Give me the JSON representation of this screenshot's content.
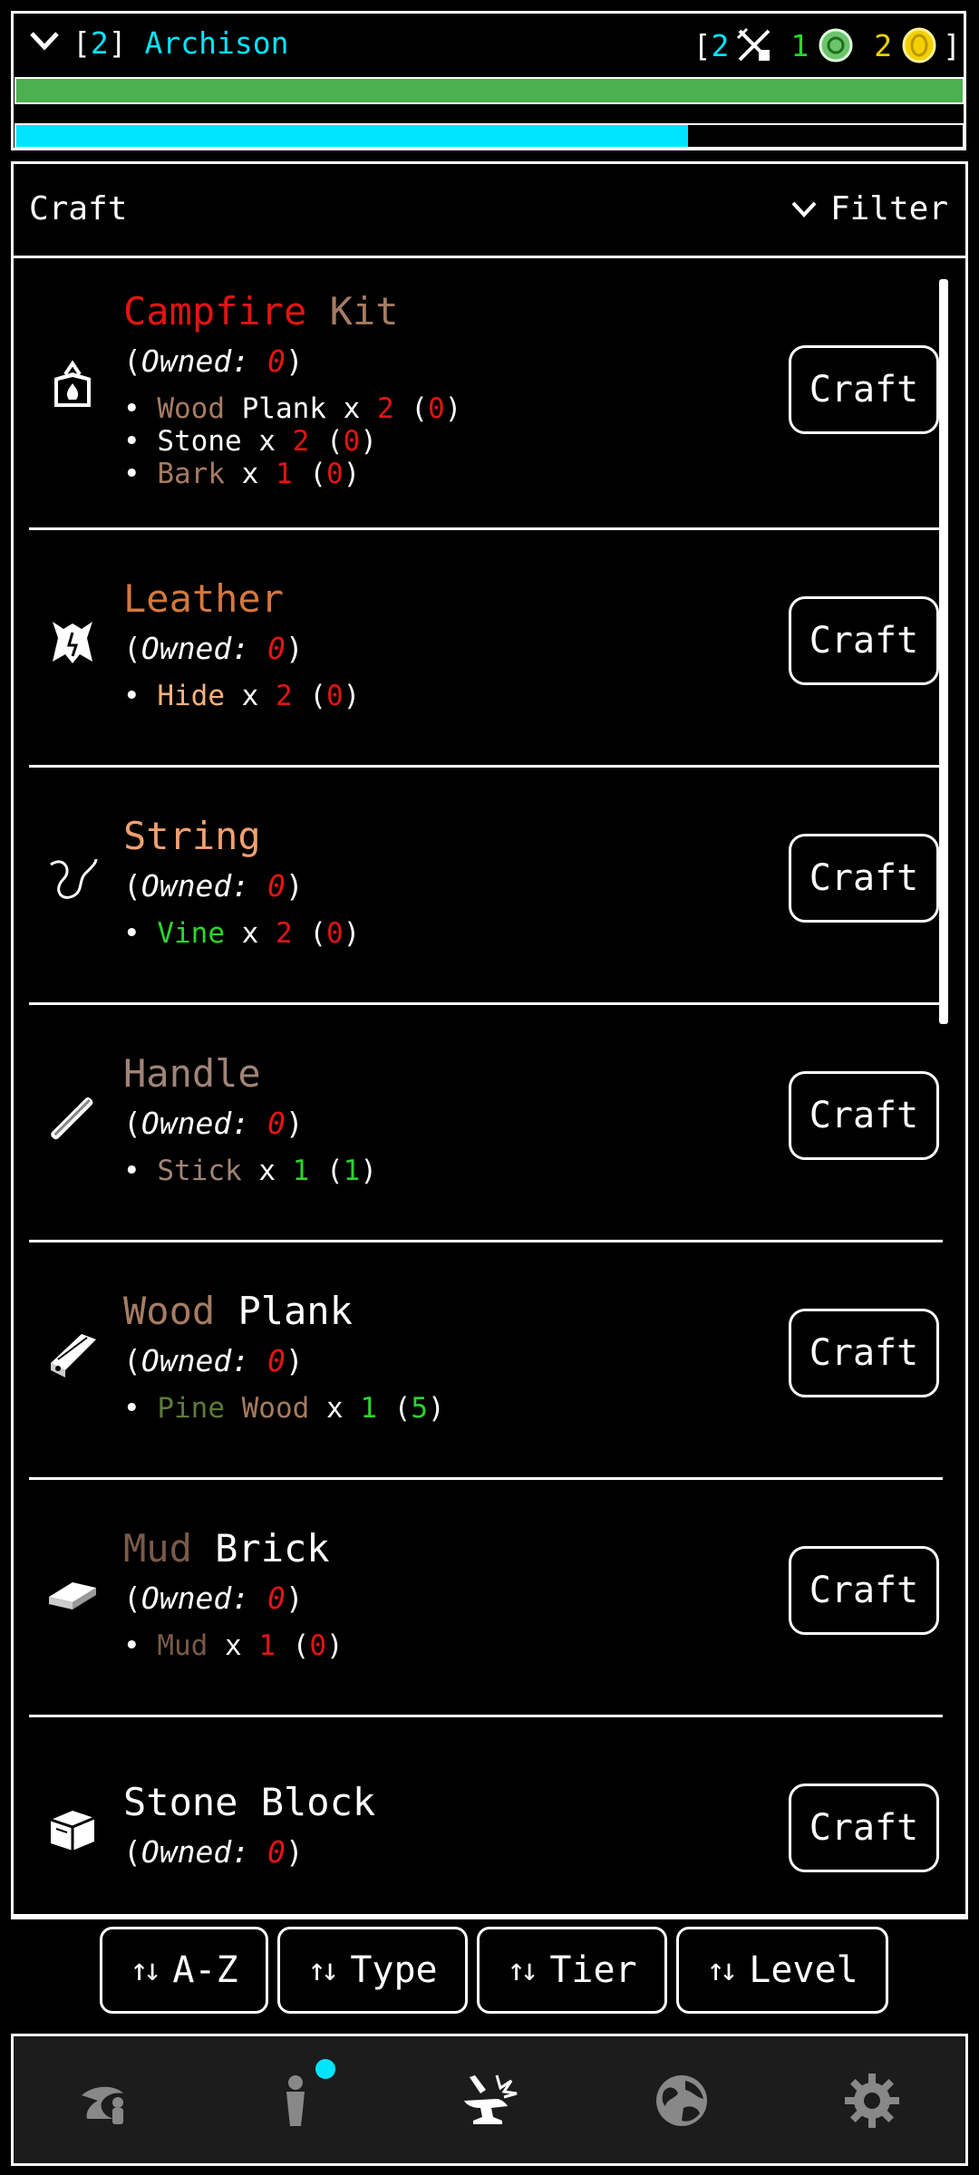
{
  "header": {
    "level_open": "[",
    "level": "2",
    "level_close": "]",
    "name": "Archison",
    "currency": {
      "open": "[",
      "a_value": "2",
      "b_value": "1",
      "c_value": "2",
      "close": "]",
      "a_icon": "sword-shovel-icon",
      "b_icon": "green-token-icon",
      "c_icon": "gold-coin-icon"
    },
    "hp_fill": 1.0,
    "xp_fill": 0.71,
    "colors": {
      "cyan": "#00e5ff",
      "green": "#4caf50",
      "gold": "#f5d000"
    }
  },
  "panel": {
    "title": "Craft",
    "filter_label": "Filter"
  },
  "craft_button_label": "Craft",
  "owned_label": "Owned:",
  "items": [
    {
      "title1": "Campfire",
      "title2": "Kit",
      "c1": "#e31414",
      "c2": "#a67c62",
      "owned": "0",
      "icon": "campfire-kit-icon",
      "reqs": [
        {
          "n1": "Wood",
          "n2": " Plank",
          "c1": "#a67c62",
          "c2": "#ffffff",
          "qty": "2",
          "have": "0",
          "ok": false
        },
        {
          "n1": "Stone",
          "n2": "",
          "c1": "#ffffff",
          "c2": "#ffffff",
          "qty": "2",
          "have": "0",
          "ok": false
        },
        {
          "n1": "Bark",
          "n2": "",
          "c1": "#a67c62",
          "c2": "#ffffff",
          "qty": "1",
          "have": "0",
          "ok": false
        }
      ]
    },
    {
      "title1": "Leather",
      "title2": "",
      "c1": "#d3783f",
      "c2": "#d3783f",
      "owned": "0",
      "icon": "leather-hide-icon",
      "reqs": [
        {
          "n1": "Hide",
          "n2": "",
          "c1": "#f5b37c",
          "c2": "#ffffff",
          "qty": "2",
          "have": "0",
          "ok": false
        }
      ]
    },
    {
      "title1": "String",
      "title2": "",
      "c1": "#f0a070",
      "c2": "#f0a070",
      "owned": "0",
      "icon": "string-icon",
      "reqs": [
        {
          "n1": "Vine",
          "n2": "",
          "c1": "#2bd62b",
          "c2": "#ffffff",
          "qty": "2",
          "have": "0",
          "ok": false
        }
      ]
    },
    {
      "title1": "Handle",
      "title2": "",
      "c1": "#a08478",
      "c2": "#a08478",
      "owned": "0",
      "icon": "handle-icon",
      "reqs": [
        {
          "n1": "Stick",
          "n2": "",
          "c1": "#a08478",
          "c2": "#ffffff",
          "qty": "1",
          "have": "1",
          "ok": true
        }
      ]
    },
    {
      "title1": "Wood",
      "title2": "Plank",
      "c1": "#a67c62",
      "c2": "#ffffff",
      "owned": "0",
      "icon": "wood-plank-icon",
      "reqs": [
        {
          "n1": "Pine",
          "n2": " Wood",
          "c1": "#5e7a3a",
          "c2": "#a67c62",
          "qty": "1",
          "have": "5",
          "ok": true
        }
      ]
    },
    {
      "title1": "Mud",
      "title2": "Brick",
      "c1": "#7a5a48",
      "c2": "#ffffff",
      "owned": "0",
      "icon": "mud-brick-icon",
      "reqs": [
        {
          "n1": "Mud",
          "n2": "",
          "c1": "#7a5a48",
          "c2": "#ffffff",
          "qty": "1",
          "have": "0",
          "ok": false
        }
      ]
    },
    {
      "title1": "Stone",
      "title2": "Block",
      "c1": "#ffffff",
      "c2": "#ffffff",
      "owned": "0",
      "icon": "stone-block-icon",
      "reqs": []
    }
  ],
  "sort_buttons": [
    "A-Z",
    "Type",
    "Tier",
    "Level"
  ],
  "sort_arrow": "↑↓",
  "nav": [
    {
      "name": "nav-explore-icon"
    },
    {
      "name": "nav-character-icon",
      "badge": true
    },
    {
      "name": "nav-craft-icon",
      "active": true
    },
    {
      "name": "nav-world-icon"
    },
    {
      "name": "nav-settings-icon"
    }
  ]
}
